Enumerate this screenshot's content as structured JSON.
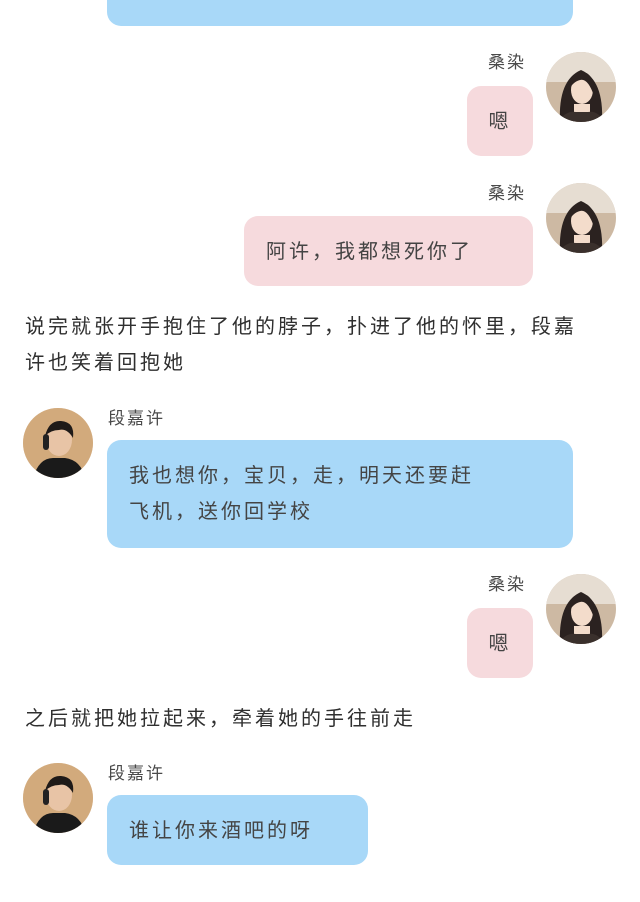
{
  "participants": {
    "female_name": "桑染",
    "male_name": "段嘉许"
  },
  "messages": [
    {
      "sender": "桑染",
      "text": "嗯"
    },
    {
      "sender": "桑染",
      "text": "阿许，我都想死你了"
    },
    {
      "narration": "说完就张开手抱住了他的脖子，扑进了他的怀里，段嘉许也笑着回抱她"
    },
    {
      "sender": "段嘉许",
      "text_line1": "我也想你，宝贝，走，明天还要赶",
      "text_line2": "飞机，送你回学校"
    },
    {
      "sender": "桑染",
      "text": "嗯"
    },
    {
      "narration": "之后就把她拉起来，牵着她的手往前走"
    },
    {
      "sender": "段嘉许",
      "text": "谁让你来酒吧的呀"
    }
  ],
  "colors": {
    "male_bubble": "#a8d8f8",
    "female_bubble": "#f6dadd"
  },
  "icons": {
    "female_avatar": "girl-portrait-avatar",
    "male_avatar": "man-phone-avatar"
  }
}
